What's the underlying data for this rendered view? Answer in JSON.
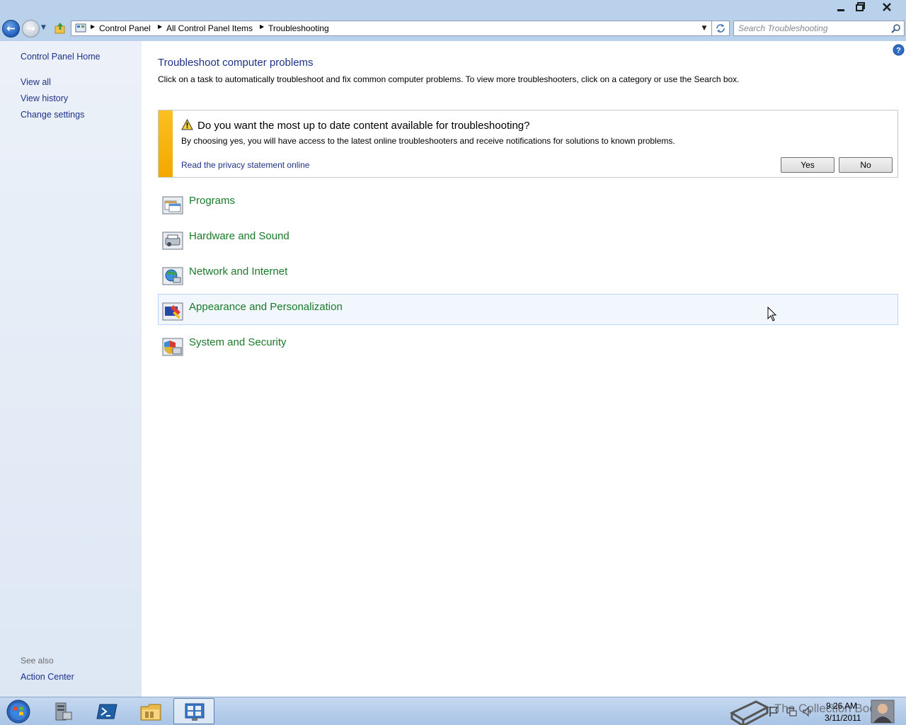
{
  "window": {
    "minimize_glyph": "▁",
    "maximize_glyph": "❐",
    "close_glyph": "✕"
  },
  "nav": {
    "breadcrumbs": [
      "Control Panel",
      "All Control Panel Items",
      "Troubleshooting"
    ],
    "search_placeholder": "Search Troubleshooting"
  },
  "sidebar": {
    "home": "Control Panel Home",
    "links": [
      "View all",
      "View history",
      "Change settings"
    ],
    "see_also_label": "See also",
    "see_also_links": [
      "Action Center"
    ]
  },
  "main": {
    "title": "Troubleshoot computer problems",
    "description": "Click on a task to automatically troubleshoot and fix common computer problems. To view more troubleshooters, click on a category or use the Search box.",
    "infobar": {
      "title": "Do you want the most up to date content available for troubleshooting?",
      "body": "By choosing yes, you will have access to the latest online troubleshooters and receive notifications for solutions to known problems.",
      "link": "Read the privacy statement online",
      "yes_label": "Yes",
      "no_label": "No"
    },
    "categories": [
      {
        "label": "Programs",
        "icon": "programs-icon"
      },
      {
        "label": "Hardware and Sound",
        "icon": "hardware-sound-icon"
      },
      {
        "label": "Network and Internet",
        "icon": "network-internet-icon"
      },
      {
        "label": "Appearance and Personalization",
        "icon": "appearance-icon"
      },
      {
        "label": "System and Security",
        "icon": "system-security-icon"
      }
    ],
    "hovered_category": "Appearance and Personalization"
  },
  "taskbar": {
    "watermark": "The Collection Book",
    "time": "9:26 AM",
    "date": "3/11/2011"
  },
  "colors": {
    "link": "#1e3287",
    "category": "#1a7a2a",
    "infobar_stripe": "#f3a800",
    "frame": "#b9d1ea"
  }
}
